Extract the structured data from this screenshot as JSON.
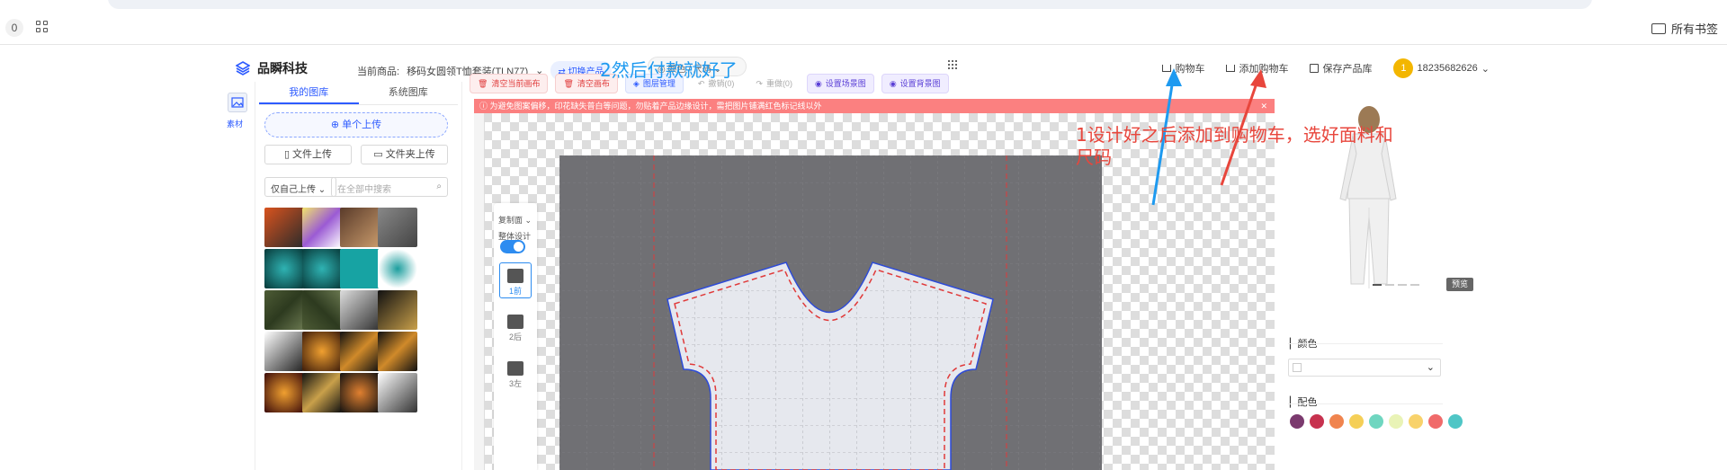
{
  "browser": {
    "tab_count": "0",
    "bookmarks_label": "所有书签"
  },
  "header": {
    "brand": "品瞬科技",
    "current_product_label": "当前商品:",
    "current_product": "移码女圆领T恤套装(TLN77)",
    "switch_product": "切换产品",
    "color_size": "颜色 / 尺码",
    "cart": "购物车",
    "add_to_cart": "添加购物车",
    "save_library": "保存产品库",
    "avatar_initial": "1",
    "phone": "18235682626"
  },
  "rail": {
    "material_label": "素材"
  },
  "library": {
    "tabs": [
      "我的图库",
      "系统图库"
    ],
    "upload_single": "单个上传",
    "file_upload": "文件上传",
    "folder_upload": "文件夹上传",
    "filter": "仅自己上传",
    "search_placeholder": "在全部中搜索"
  },
  "toolbar": {
    "clear_current": "清空当前画布",
    "clear_canvas": "清空画布",
    "layer_manage": "图层管理",
    "undo": "撤销(0)",
    "redo": "重做(0)",
    "set_scene": "设置场景图",
    "set_background": "设置背景图"
  },
  "warning": "为避免图案偏移，印花缺失普白等问题，勿贴着产品边缘设计，需把图片铺满红色标记线以外",
  "side_tools": {
    "copy": "复制面",
    "whole_design": "整体设计",
    "views": [
      "1前",
      "2后",
      "3左"
    ]
  },
  "right_panel": {
    "preview_btn": "预览",
    "color_label": "颜色",
    "match_label": "配色",
    "swatches": [
      "#7b3a6e",
      "#c7324f",
      "#f0844e",
      "#f5cf57",
      "#6fd6c0",
      "#e9f3b6",
      "#f8d26b",
      "#f06a6a",
      "#4fc6c6"
    ]
  },
  "annotations": {
    "blue": "2然后付款就好了",
    "red": "1设计好之后添加到购物车，选好面料和尺码"
  }
}
